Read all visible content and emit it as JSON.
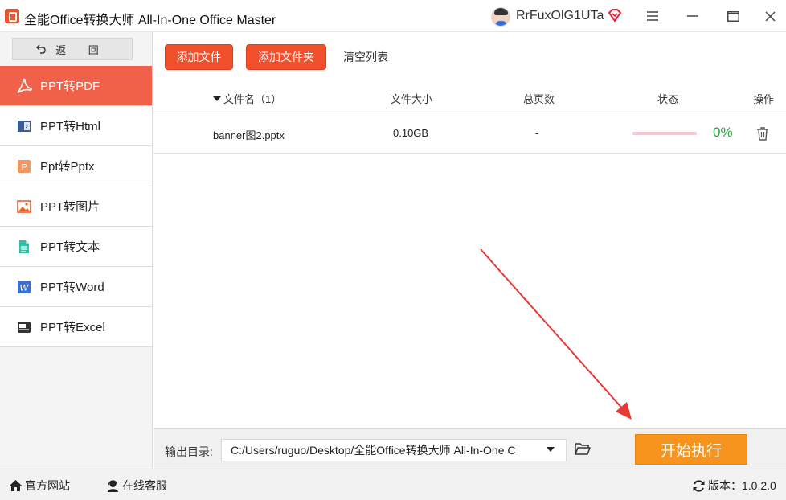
{
  "window": {
    "title": "全能Office转换大师 All-In-One Office Master",
    "username": "RrFuxOlG1UTa",
    "controls": [
      "menu-icon",
      "minimize-icon",
      "maximize-icon",
      "close-icon"
    ]
  },
  "sidebar": {
    "back_label": "返 回",
    "items": [
      {
        "label": "PPT转PDF",
        "icon": "pdf-icon",
        "active": true
      },
      {
        "label": "PPT转Html",
        "icon": "html-icon",
        "active": false
      },
      {
        "label": "Ppt转Pptx",
        "icon": "pptx-icon",
        "active": false
      },
      {
        "label": "PPT转图片",
        "icon": "image-icon",
        "active": false
      },
      {
        "label": "PPT转文本",
        "icon": "text-icon",
        "active": false
      },
      {
        "label": "PPT转Word",
        "icon": "word-icon",
        "active": false
      },
      {
        "label": "PPT转Excel",
        "icon": "excel-icon",
        "active": false
      }
    ]
  },
  "toolbar": {
    "add_file": "添加文件",
    "add_folder": "添加文件夹",
    "clear_list": "清空列表"
  },
  "table": {
    "headers": {
      "name": "文件名（1）",
      "size": "文件大小",
      "pages": "总页数",
      "status": "状态",
      "ops": "操作"
    },
    "rows": [
      {
        "name": "banner图2.pptx",
        "size": "0.10GB",
        "pages": "-",
        "progress_percent": 0,
        "progress_text": "0%"
      }
    ]
  },
  "output": {
    "label": "输出目录:",
    "path": "C:/Users/ruguo/Desktop/全能Office转换大师 All-In-One C",
    "start_label": "开始执行"
  },
  "statusbar": {
    "website": "官方网站",
    "service": "在线客服",
    "version": "版本：1.0.2.0"
  },
  "colors": {
    "accent_active": "#f0614a",
    "button_orange": "#f2502d",
    "start_button": "#f7941d",
    "progress_text": "#2aa23b",
    "arrow": "#e53935"
  }
}
